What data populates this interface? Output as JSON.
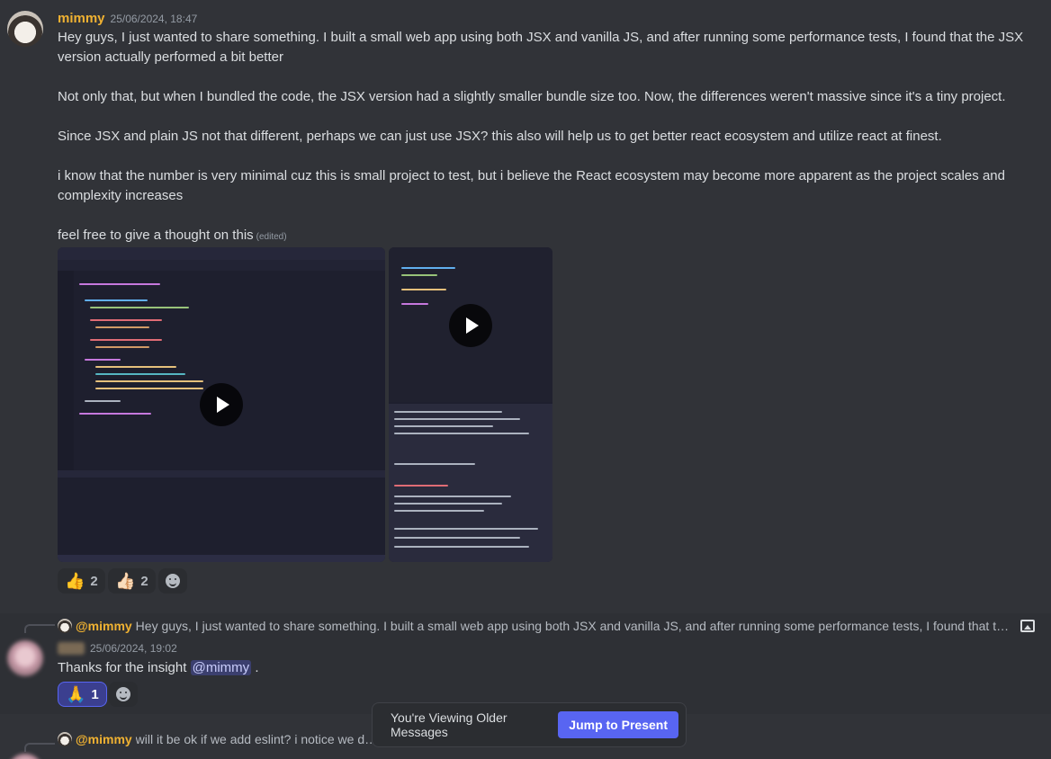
{
  "message_main": {
    "username": "mimmy",
    "timestamp": "25/06/2024, 18:47",
    "paragraphs": [
      "Hey guys, I just wanted to share something. I built a small web app using both JSX and vanilla JS, and after running some performance tests, I found that the JSX version actually performed a bit better",
      "Not only that, but when I bundled the code, the JSX version had a slightly smaller bundle size too. Now, the differences weren't massive since it's a tiny project.",
      "Since JSX and plain JS not that different, perhaps we can just use JSX? this also will help us to get better react ecosystem and utilize react at finest.",
      "i know that the number is very minimal cuz this is small project to test, but i believe the React ecosystem may become more apparent as the project scales and complexity increases",
      "feel free to give a thought on this"
    ],
    "edited_label": "(edited)",
    "reactions": [
      {
        "emoji": "👍",
        "count": "2"
      },
      {
        "emoji": "👍🏻",
        "count": "2"
      }
    ]
  },
  "reply_one": {
    "reply_to_user": "@mimmy",
    "reply_preview": "Hey guys, I just wanted to share something. I built a small web app using both JSX and vanilla JS, and after running some performance tests, I found that the JSX ve...",
    "timestamp": "25/06/2024, 19:02",
    "text_before": "Thanks for the insight",
    "mention": "@mimmy",
    "text_after": ".",
    "reactions": [
      {
        "emoji": "🙏",
        "count": "1"
      }
    ]
  },
  "reply_two": {
    "reply_to_user": "@mimmy",
    "reply_preview": "will it be ok if we add eslint? i notice we dont h"
  },
  "banner": {
    "text": "You're Viewing Older Messages",
    "button": "Jump to Present"
  },
  "colors": {
    "background": "#313338",
    "username": "#f0b232",
    "accent": "#5865f2"
  }
}
